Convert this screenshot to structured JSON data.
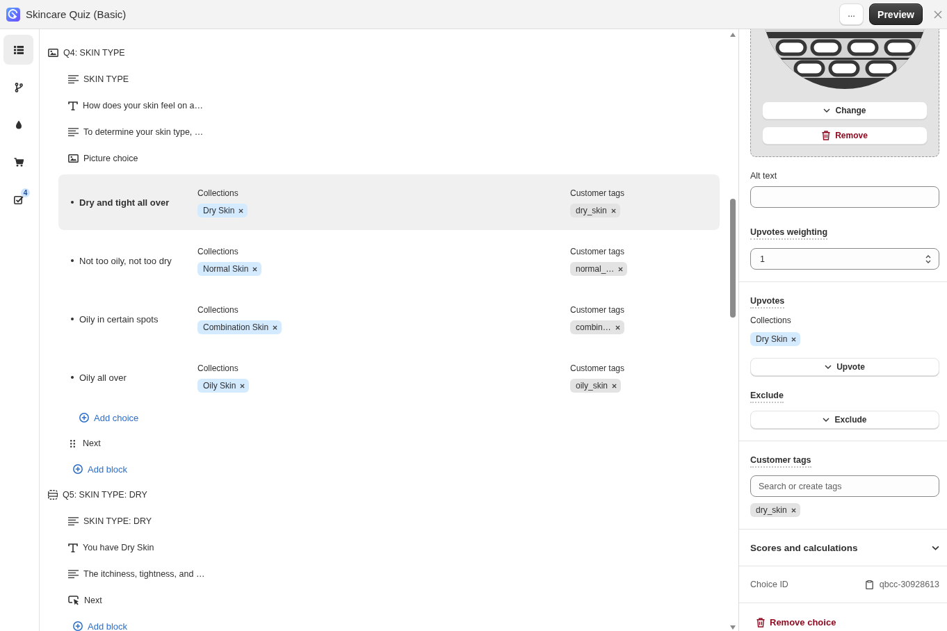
{
  "window": {
    "title": "Skincare Quiz (Basic)",
    "more_label": "...",
    "preview_label": "Preview"
  },
  "rail": [
    {
      "kind": "list",
      "selected": true
    },
    {
      "kind": "branch",
      "selected": false
    },
    {
      "kind": "drop",
      "selected": false
    },
    {
      "kind": "cart",
      "selected": false
    },
    {
      "kind": "checklist",
      "selected": false,
      "badge": "4"
    }
  ],
  "tree": [
    {
      "kind": "image",
      "label": "Q4: SKIN TYPE",
      "children": [
        {
          "kind": "lines",
          "label": "SKIN TYPE"
        },
        {
          "kind": "text",
          "label": "How does your skin feel on a…"
        },
        {
          "kind": "lines",
          "label": "To determine your skin type, …"
        },
        {
          "kind": "image",
          "label": "Picture choice"
        },
        {
          "kind": "choices",
          "add_label": "Add choice",
          "items": [
            {
              "label": "Dry and tight all over",
              "selected": true,
              "collections_label": "Collections",
              "collections": [
                "Dry Skin"
              ],
              "tags_label": "Customer tags",
              "tags": [
                "dry_skin"
              ]
            },
            {
              "label": "Not too oily, not too dry",
              "selected": false,
              "collections_label": "Collections",
              "collections": [
                "Normal Skin"
              ],
              "tags_label": "Customer tags",
              "tags": [
                "normal_…"
              ]
            },
            {
              "label": "Oily in certain spots",
              "selected": false,
              "collections_label": "Collections",
              "collections": [
                "Combination Skin"
              ],
              "tags_label": "Customer tags",
              "tags": [
                "combin…"
              ]
            },
            {
              "label": "Oily all over",
              "selected": false,
              "collections_label": "Collections",
              "collections": [
                "Oily Skin"
              ],
              "tags_label": "Customer tags",
              "tags": [
                "oily_skin"
              ]
            }
          ]
        },
        {
          "kind": "grip",
          "label": "Next"
        },
        {
          "kind": "add",
          "label": "Add block"
        }
      ]
    },
    {
      "kind": "section",
      "label": "Q5: SKIN TYPE: DRY",
      "children": [
        {
          "kind": "lines",
          "label": "SKIN TYPE: DRY"
        },
        {
          "kind": "text",
          "label": "You have Dry Skin"
        },
        {
          "kind": "lines",
          "label": "The itchiness, tightness, and …"
        },
        {
          "kind": "click",
          "label": "Next"
        },
        {
          "kind": "add",
          "label": "Add block"
        }
      ]
    }
  ],
  "inspector": {
    "image_actions": [
      {
        "kind": "change",
        "label": "Change"
      },
      {
        "kind": "remove",
        "label": "Remove"
      }
    ],
    "alt_text": {
      "label": "Alt text"
    },
    "weighting": {
      "label": "Upvotes weighting",
      "value": "1"
    },
    "upvotes": {
      "label": "Upvotes",
      "collections_label": "Collections",
      "collections": [
        "Dry Skin"
      ],
      "button": "Upvote"
    },
    "exclude": {
      "label": "Exclude",
      "button": "Exclude"
    },
    "customer_tags": {
      "label": "Customer tags",
      "placeholder": "Search or create tags",
      "tags": [
        "dry_skin"
      ]
    },
    "scores": {
      "label": "Scores and calculations",
      "expanded": false
    },
    "choice_id": {
      "label": "Choice ID",
      "value": "qbcc-30928613"
    },
    "remove_choice": "Remove choice"
  }
}
